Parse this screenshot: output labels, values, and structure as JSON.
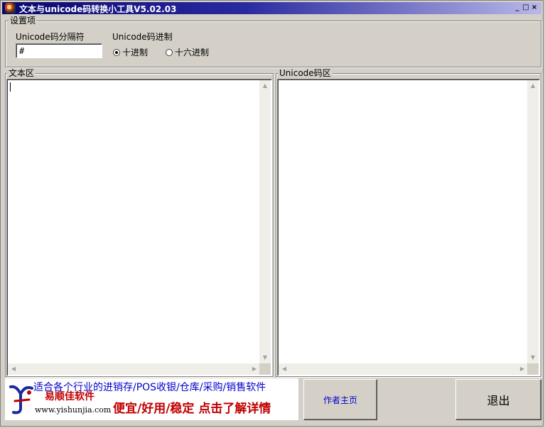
{
  "window": {
    "title": "文本与unicode码转换小工具V5.02.03",
    "minimize_glyph": "_",
    "maximize_glyph": "□",
    "close_glyph": "×"
  },
  "settings": {
    "group_label": "设置项",
    "separator_label": "Unicode码分隔符",
    "separator_value": "#",
    "radix_label": "Unicode码进制",
    "radix_options": [
      {
        "label": "十进制",
        "selected": true
      },
      {
        "label": "十六进制",
        "selected": false
      }
    ]
  },
  "text_area": {
    "group_label": "文本区",
    "value": ""
  },
  "unicode_area": {
    "group_label": "Unicode码区",
    "value": ""
  },
  "scroll_glyphs": {
    "up": "▲",
    "down": "▼",
    "left": "◀",
    "right": "▶"
  },
  "banner": {
    "line1": "适合各个行业的进销存/POS收银/仓库/采购/销售软件",
    "brand_cn": "易顺佳软件",
    "brand_url": "www.yishunjia.com",
    "line2": "便宜/好用/稳定 点击了解详情",
    "colors": {
      "blue": "#0000cc",
      "red": "#c00000"
    }
  },
  "buttons": {
    "author_home": "作者主页",
    "exit": "退出"
  },
  "colors": {
    "titlebar_start": "#080870",
    "titlebar_end": "#b8b8e8",
    "face": "#d4d0c8",
    "link_blue": "#0000cc"
  }
}
